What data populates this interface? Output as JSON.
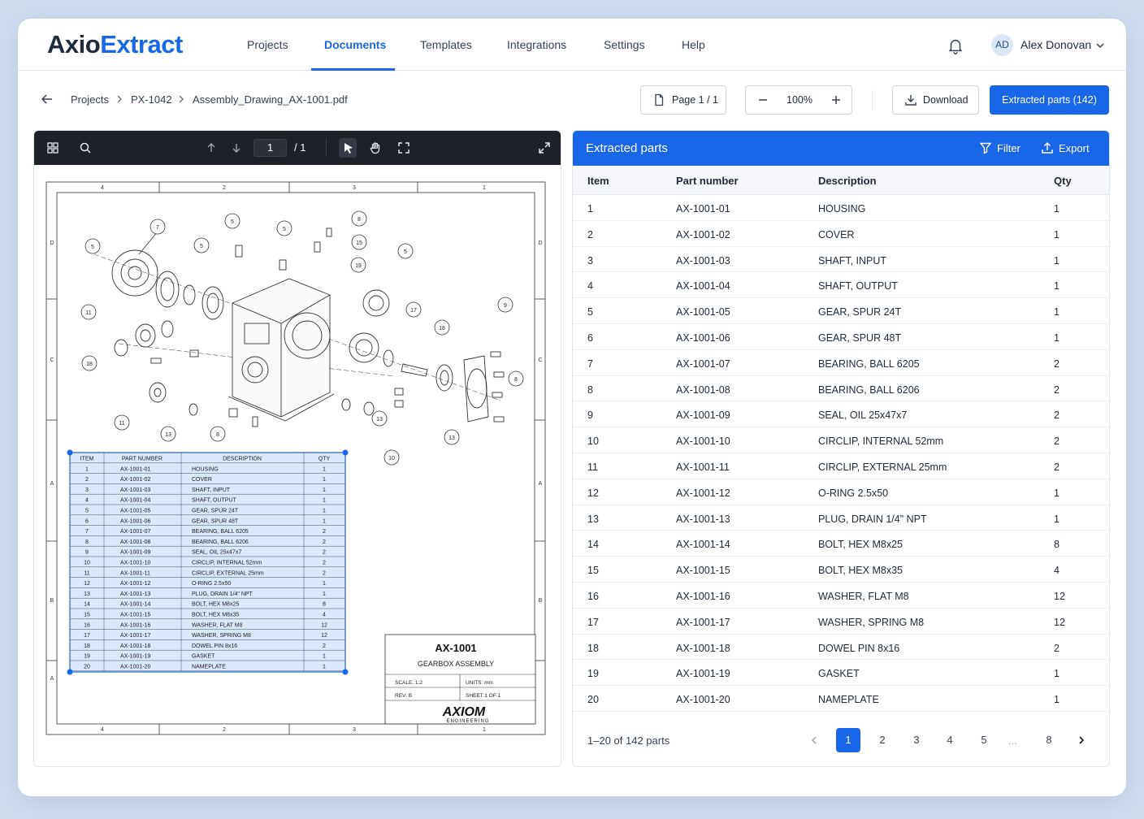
{
  "brand": {
    "part1": "Axio",
    "part2": "Extract"
  },
  "nav": {
    "items": [
      {
        "label": "Projects"
      },
      {
        "label": "Documents"
      },
      {
        "label": "Templates"
      },
      {
        "label": "Integrations"
      },
      {
        "label": "Settings"
      },
      {
        "label": "Help"
      }
    ],
    "active": "Documents"
  },
  "user": {
    "initials": "AD",
    "name": "Alex Donovan"
  },
  "breadcrumb": [
    "Projects",
    "PX-1042",
    "Assembly_Drawing_AX-1001.pdf"
  ],
  "toolbar": {
    "page_label": "Page 1 / 1",
    "zoom": "100%",
    "download_label": "Download",
    "extracted_label": "Extracted parts (142)"
  },
  "viewer": {
    "current_page": "1",
    "total_pages": "/ 1",
    "drawing": {
      "zone_top": [
        "4",
        "2",
        "3",
        "1"
      ],
      "zone_side": [
        "D",
        "C",
        "A",
        "B",
        "A"
      ],
      "bom_headers": [
        "ITEM",
        "PART NUMBER",
        "DESCRIPTION",
        "QTY"
      ],
      "balloons": [
        "7",
        "5",
        "5",
        "5",
        "5",
        "8",
        "15",
        "19",
        "5",
        "11",
        "18",
        "17",
        "18",
        "9",
        "11",
        "13",
        "8",
        "13",
        "13",
        "10",
        "8"
      ],
      "title": "AX-1001",
      "subtitle": "GEARBOX ASSEMBLY",
      "scale": "SCALE: 1:2",
      "units": "UNITS: mm",
      "rev": "REV: B",
      "sheet": "SHEET 1 OF 1",
      "logo_main": "AXIOM",
      "logo_sub": "ENGINEERING"
    }
  },
  "parts_panel": {
    "title": "Extracted parts",
    "filter_label": "Filter",
    "export_label": "Export",
    "columns": [
      "Item",
      "Part number",
      "Description",
      "Qty"
    ],
    "rows": [
      {
        "item": "1",
        "part": "AX-1001-01",
        "desc": "HOUSING",
        "qty": "1"
      },
      {
        "item": "2",
        "part": "AX-1001-02",
        "desc": "COVER",
        "qty": "1"
      },
      {
        "item": "3",
        "part": "AX-1001-03",
        "desc": "SHAFT, INPUT",
        "qty": "1"
      },
      {
        "item": "4",
        "part": "AX-1001-04",
        "desc": "SHAFT, OUTPUT",
        "qty": "1"
      },
      {
        "item": "5",
        "part": "AX-1001-05",
        "desc": "GEAR, SPUR 24T",
        "qty": "1"
      },
      {
        "item": "6",
        "part": "AX-1001-06",
        "desc": "GEAR, SPUR 48T",
        "qty": "1"
      },
      {
        "item": "7",
        "part": "AX-1001-07",
        "desc": "BEARING, BALL 6205",
        "qty": "2"
      },
      {
        "item": "8",
        "part": "AX-1001-08",
        "desc": "BEARING, BALL 6206",
        "qty": "2"
      },
      {
        "item": "9",
        "part": "AX-1001-09",
        "desc": "SEAL, OIL 25x47x7",
        "qty": "2"
      },
      {
        "item": "10",
        "part": "AX-1001-10",
        "desc": "CIRCLIP, INTERNAL 52mm",
        "qty": "2"
      },
      {
        "item": "11",
        "part": "AX-1001-11",
        "desc": "CIRCLIP, EXTERNAL 25mm",
        "qty": "2"
      },
      {
        "item": "12",
        "part": "AX-1001-12",
        "desc": "O-RING 2.5x50",
        "qty": "1"
      },
      {
        "item": "13",
        "part": "AX-1001-13",
        "desc": "PLUG, DRAIN 1/4\" NPT",
        "qty": "1"
      },
      {
        "item": "14",
        "part": "AX-1001-14",
        "desc": "BOLT, HEX M8x25",
        "qty": "8"
      },
      {
        "item": "15",
        "part": "AX-1001-15",
        "desc": "BOLT, HEX M8x35",
        "qty": "4"
      },
      {
        "item": "16",
        "part": "AX-1001-16",
        "desc": "WASHER, FLAT M8",
        "qty": "12"
      },
      {
        "item": "17",
        "part": "AX-1001-17",
        "desc": "WASHER, SPRING M8",
        "qty": "12"
      },
      {
        "item": "18",
        "part": "AX-1001-18",
        "desc": "DOWEL PIN 8x16",
        "qty": "2"
      },
      {
        "item": "19",
        "part": "AX-1001-19",
        "desc": "GASKET",
        "qty": "1"
      },
      {
        "item": "20",
        "part": "AX-1001-20",
        "desc": "NAMEPLATE",
        "qty": "1"
      }
    ],
    "pagination": {
      "info": "1–20 of 142 parts",
      "pages": [
        "1",
        "2",
        "3",
        "4",
        "5",
        "8"
      ],
      "ellipsis": "...",
      "current": "1"
    }
  },
  "colors": {
    "accent": "#1867e8",
    "viewer_bar": "#1e2127",
    "bom_highlight": "#dbe8fb"
  }
}
